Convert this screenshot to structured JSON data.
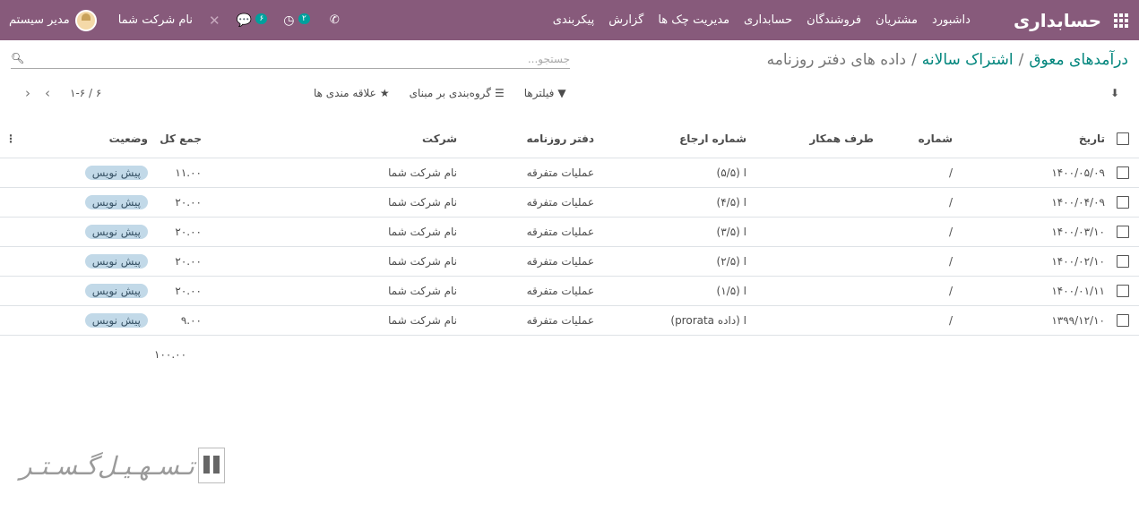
{
  "navbar": {
    "brand": "حسابداری",
    "menu": [
      "داشبورد",
      "مشتریان",
      "فروشندگان",
      "حسابداری",
      "مدیریت چک ها",
      "گزارش",
      "پیکربندی"
    ],
    "user_name": "مدیر سیستم",
    "company_name": "نام شرکت شما",
    "chat_badge": "۶",
    "activity_badge": "۲"
  },
  "breadcrumb": {
    "crumb1": "درآمدهای معوق",
    "crumb2": "اشتراک سالانه",
    "current": "داده های دفتر روزنامه"
  },
  "search": {
    "placeholder": "جستجو..."
  },
  "controls": {
    "filters": "فیلترها",
    "group_by": "گروه‌بندی بر مبنای",
    "favorites": "علاقه مندی ها",
    "pager": "۱-۶ / ۶"
  },
  "table": {
    "columns": {
      "date": "تاریخ",
      "number": "شماره",
      "partner": "طرف همکار",
      "reference": "شماره ارجاع",
      "journal": "دفتر روزنامه",
      "company": "شرکت",
      "total": "جمع کل",
      "state": "وضعیت"
    },
    "rows": [
      {
        "date": "۱۴۰۰/۰۵/۰۹",
        "number": "/",
        "partner": "",
        "reference": "ا (۵/۵)",
        "journal": "عملیات متفرقه",
        "company": "نام شرکت شما",
        "total": "۱۱.۰۰",
        "state": "پیش نویس"
      },
      {
        "date": "۱۴۰۰/۰۴/۰۹",
        "number": "/",
        "partner": "",
        "reference": "ا (۴/۵)",
        "journal": "عملیات متفرقه",
        "company": "نام شرکت شما",
        "total": "۲۰.۰۰",
        "state": "پیش نویس"
      },
      {
        "date": "۱۴۰۰/۰۳/۱۰",
        "number": "/",
        "partner": "",
        "reference": "ا (۳/۵)",
        "journal": "عملیات متفرقه",
        "company": "نام شرکت شما",
        "total": "۲۰.۰۰",
        "state": "پیش نویس"
      },
      {
        "date": "۱۴۰۰/۰۲/۱۰",
        "number": "/",
        "partner": "",
        "reference": "ا (۲/۵)",
        "journal": "عملیات متفرقه",
        "company": "نام شرکت شما",
        "total": "۲۰.۰۰",
        "state": "پیش نویس"
      },
      {
        "date": "۱۴۰۰/۰۱/۱۱",
        "number": "/",
        "partner": "",
        "reference": "ا (۱/۵)",
        "journal": "عملیات متفرقه",
        "company": "نام شرکت شما",
        "total": "۲۰.۰۰",
        "state": "پیش نویس"
      },
      {
        "date": "۱۳۹۹/۱۲/۱۰",
        "number": "/",
        "partner": "",
        "reference": "ا (داده prorata)",
        "journal": "عملیات متفرقه",
        "company": "نام شرکت شما",
        "total": "۹.۰۰",
        "state": "پیش نویس"
      }
    ],
    "sum_total": "۱۰۰.۰۰"
  },
  "watermark": {
    "text": "تـسـهـیـل‌گـسـتـر"
  },
  "colors": {
    "navbar": "#875a7b",
    "link": "#00857c",
    "badge": "#00a09d",
    "pill": "#c2d9e8"
  }
}
